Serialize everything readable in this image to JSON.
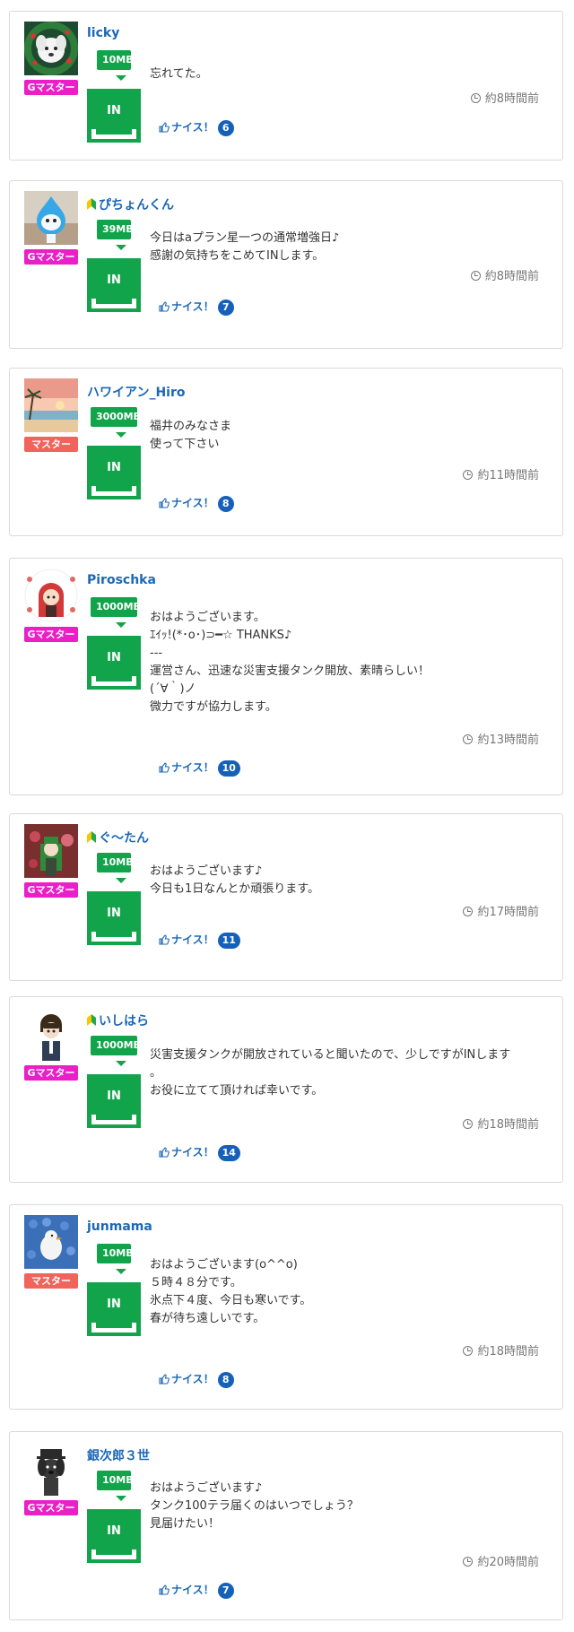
{
  "posts": [
    {
      "user": "licky",
      "beginner": false,
      "rank": "Gマスター",
      "tank_mb": "10MB",
      "action": "IN",
      "message_lines": [
        "忘れてた。"
      ],
      "time": "約8時間前",
      "nice_label": "ナイス！",
      "nice_count": "6",
      "avatar_icon": "white-dog-wreath-icon",
      "colors": {
        "rank": "#ea1fc7"
      }
    },
    {
      "user": "ぴちょんくん",
      "beginner": true,
      "rank": "Gマスター",
      "tank_mb": "39MB",
      "action": "IN",
      "message_lines": [
        "今日はaプラン星一つの通常増強日♪",
        "感謝の気持ちをこめてINします。"
      ],
      "time": "約8時間前",
      "nice_label": "ナイス！",
      "nice_count": "7",
      "avatar_icon": "blue-droplet-character-icon",
      "colors": {
        "rank": "#ea1fc7"
      }
    },
    {
      "user": "ハワイアン_Hiro",
      "beginner": false,
      "rank": "マスター",
      "tank_mb": "3000MB",
      "action": "IN",
      "message_lines": [
        "福井のみなさま",
        "使って下さい"
      ],
      "time": "約11時間前",
      "nice_label": "ナイス！",
      "nice_count": "8",
      "avatar_icon": "sunset-beach-icon",
      "colors": {
        "rank": "#f0645c"
      }
    },
    {
      "user": "Piroschka",
      "beginner": false,
      "rank": "Gマスター",
      "tank_mb": "1000MB",
      "action": "IN",
      "message_lines": [
        "おはようございます。",
        "ｴｲｯ!(*･o･)⊃━☆ THANKS♪",
        "---",
        "運営さん、迅速な災害支援タンク開放、素晴らしい！",
        "(´∀｀)ノ",
        "微力ですが協力します。"
      ],
      "time": "約13時間前",
      "nice_label": "ナイス！",
      "nice_count": "10",
      "avatar_icon": "red-hood-girl-icon",
      "colors": {
        "rank": "#ea1fc7"
      }
    },
    {
      "user": "ぐ～たん",
      "beginner": true,
      "rank": "Gマスター",
      "tank_mb": "10MB",
      "action": "IN",
      "message_lines": [
        "おはようございます♪",
        "今日も1日なんとか頑張ります。"
      ],
      "time": "約17時間前",
      "nice_label": "ナイス！",
      "nice_count": "11",
      "avatar_icon": "anime-character-icon",
      "colors": {
        "rank": "#ea1fc7"
      }
    },
    {
      "user": "いしはら",
      "beginner": true,
      "rank": "Gマスター",
      "tank_mb": "1000MB",
      "action": "IN",
      "message_lines": [
        "災害支援タンクが開放されていると聞いたので、少しですがINします",
        "。",
        "お役に立てて頂ければ幸いです。"
      ],
      "time": "約18時間前",
      "nice_label": "ナイス！",
      "nice_count": "14",
      "avatar_icon": "anime-boy-icon",
      "colors": {
        "rank": "#ea1fc7"
      }
    },
    {
      "user": "junmama",
      "beginner": false,
      "rank": "マスター",
      "tank_mb": "10MB",
      "action": "IN",
      "message_lines": [
        "おはようございます(o^^o)",
        "５時４８分です。",
        "氷点下４度、今日も寒いです。",
        "春が待ち遠しいです。"
      ],
      "time": "約18時間前",
      "nice_label": "ナイス！",
      "nice_count": "8",
      "avatar_icon": "blue-flowers-bird-icon",
      "colors": {
        "rank": "#f0645c"
      }
    },
    {
      "user": "銀次郎３世",
      "beginner": false,
      "rank": "Gマスター",
      "tank_mb": "10MB",
      "action": "IN",
      "message_lines": [
        "おはようございます♪",
        "タンク100テラ届くのはいつでしょう？",
        "見届けたい！"
      ],
      "time": "約20時間前",
      "nice_label": "ナイス！",
      "nice_count": "7",
      "avatar_icon": "black-dog-hat-icon",
      "colors": {
        "rank": "#ea1fc7"
      }
    }
  ],
  "colors": {
    "link": "#1b68b7",
    "tank": "#12a44a",
    "nice_badge": "#1560b8",
    "g_master": "#ea1fc7",
    "master": "#f0645c"
  }
}
